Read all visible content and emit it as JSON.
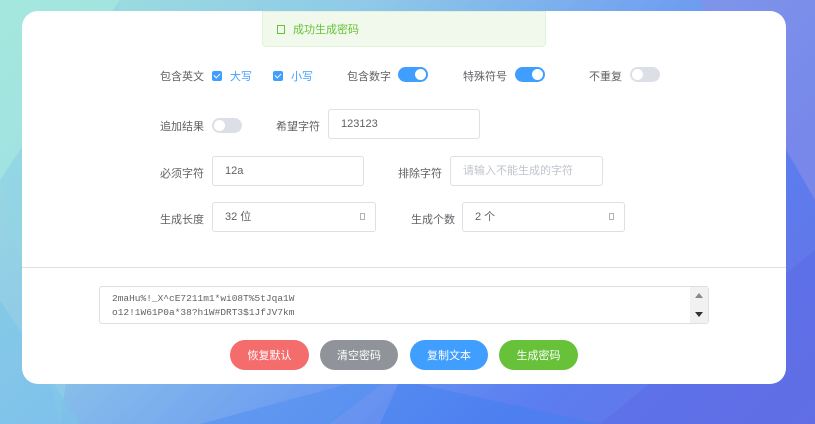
{
  "toast": {
    "message": "成功生成密码",
    "icon": "success-icon"
  },
  "options": {
    "include_letters_label": "包含英文",
    "uppercase_label": "大写",
    "uppercase_checked": true,
    "lowercase_label": "小写",
    "lowercase_checked": true,
    "include_digits_label": "包含数字",
    "include_digits_on": true,
    "special_chars_label": "特殊符号",
    "special_chars_on": true,
    "no_repeat_label": "不重复",
    "no_repeat_on": false,
    "append_result_label": "追加结果",
    "append_result_on": false,
    "wanted_chars_label": "希望字符",
    "wanted_chars_value": "123123",
    "required_chars_label": "必须字符",
    "required_chars_value": "12a",
    "excluded_chars_label": "排除字符",
    "excluded_chars_placeholder": "请输入不能生成的字符",
    "length_label": "生成长度",
    "length_value": "32 位",
    "count_label": "生成个数",
    "count_value": "2 个"
  },
  "result": {
    "lines": [
      "2maHu%!_X^cE7211m1*wi08T%5tJqa1W",
      "o12!1W61P0a*38?h1W#DRT3$1JfJV7km"
    ]
  },
  "buttons": {
    "reset": "恢复默认",
    "clear": "清空密码",
    "copy": "复制文本",
    "generate": "生成密码"
  },
  "colors": {
    "primary": "#409eff",
    "success": "#67c23a",
    "danger": "#f56c6c",
    "info": "#909399"
  }
}
